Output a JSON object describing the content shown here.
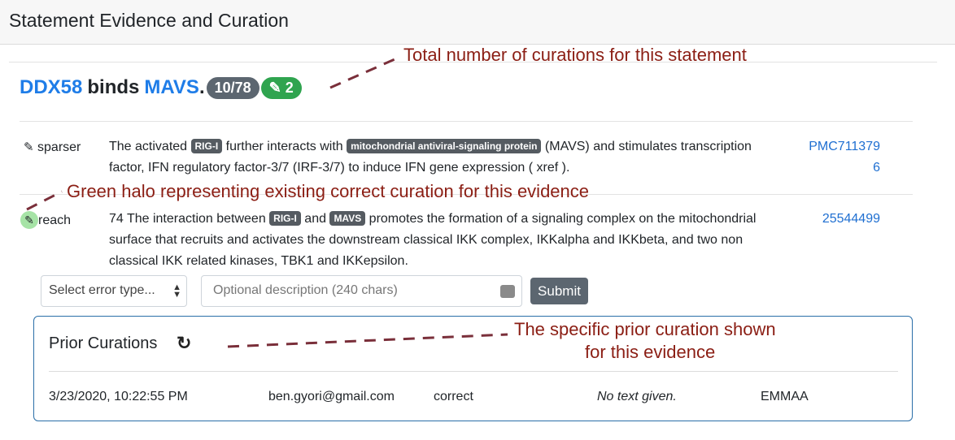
{
  "header": {
    "title": "Statement Evidence and Curation"
  },
  "statement": {
    "subject": "DDX58",
    "verb": "binds",
    "object": "MAVS",
    "period": ".",
    "count_badge": "10/78",
    "curation_badge": "✎ 2"
  },
  "evidence": [
    {
      "source": "sparser",
      "pencil": "✎",
      "text_parts": [
        {
          "t": "text",
          "v": "The activated "
        },
        {
          "t": "tag",
          "v": "RIG-I"
        },
        {
          "t": "text",
          "v": " further interacts with "
        },
        {
          "t": "tag",
          "v": "mitochondrial antiviral-signaling protein"
        },
        {
          "t": "text",
          "v": " (MAVS) and stimulates transcription factor, IFN regulatory factor-3/7 (IRF-3/7) to induce IFN gene expression ( xref )."
        }
      ],
      "link_line1": "PMC711379",
      "link_line2": "6"
    },
    {
      "source": "reach",
      "pencil": "✎",
      "text_parts": [
        {
          "t": "text",
          "v": "74 The interaction between "
        },
        {
          "t": "tag",
          "v": "RIG-I"
        },
        {
          "t": "text",
          "v": " and "
        },
        {
          "t": "tag",
          "v": "MAVS"
        },
        {
          "t": "text",
          "v": " promotes the formation of a signaling complex on the mitochondrial surface that recruits and activates the downstream classical IKK complex, IKKalpha and IKKbeta, and two non classical IKK related kinases, TBK1 and IKKepsilon."
        }
      ],
      "link_line1": "25544499"
    }
  ],
  "curation_form": {
    "error_select": "Select error type...",
    "description_placeholder": "Optional description (240 chars)",
    "submit_label": "Submit"
  },
  "prior_curations": {
    "title": "Prior Curations",
    "refresh_icon": "↻",
    "rows": [
      {
        "timestamp": "3/23/2020, 10:22:55 PM",
        "curator": "ben.gyori@gmail.com",
        "tag": "correct",
        "text": "No text given.",
        "source": "EMMAA"
      }
    ]
  },
  "annotations": {
    "total": "Total number of curations for this statement",
    "halo": "Green halo representing existing correct curation for this evidence",
    "prior_line1": "The specific prior curation shown",
    "prior_line2": "for this evidence"
  },
  "colors": {
    "link": "#1f7de8",
    "count_badge": "#5c6670",
    "curation_badge": "#2fa44f",
    "halo": "#a6e3a6",
    "annotation": "#8b1e14",
    "prior_border": "#2a6ea8"
  }
}
